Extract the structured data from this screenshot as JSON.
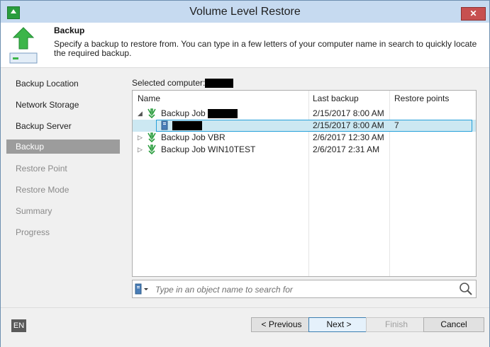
{
  "window": {
    "title": "Volume Level Restore",
    "close_label": "✕"
  },
  "header": {
    "title": "Backup",
    "description": "Specify a backup to restore from. You can type in a few letters of your computer name in search to quickly locate the required backup."
  },
  "nav": {
    "items": [
      {
        "label": "Backup Location",
        "state": "normal"
      },
      {
        "label": "Network Storage",
        "state": "normal"
      },
      {
        "label": "Backup Server",
        "state": "normal"
      },
      {
        "label": "Backup",
        "state": "active"
      },
      {
        "label": "Restore Point",
        "state": "disabled"
      },
      {
        "label": "Restore Mode",
        "state": "disabled"
      },
      {
        "label": "Summary",
        "state": "disabled"
      },
      {
        "label": "Progress",
        "state": "disabled"
      }
    ]
  },
  "main": {
    "selected_computer_label": "Selected computer:",
    "columns": [
      "Name",
      "Last backup",
      "Restore points"
    ],
    "rows": [
      {
        "name": "Backup Job",
        "last_backup": "2/15/2017 8:00 AM",
        "restore_points": "",
        "expanded": true,
        "level": 0
      },
      {
        "name": "",
        "last_backup": "2/15/2017 8:00 AM",
        "restore_points": "7",
        "level": 1,
        "selected": true
      },
      {
        "name": "Backup Job VBR",
        "last_backup": "2/6/2017 12:30 AM",
        "restore_points": "",
        "expanded": false,
        "level": 0
      },
      {
        "name": "Backup Job WIN10TEST",
        "last_backup": "2/6/2017 2:31 AM",
        "restore_points": "",
        "expanded": false,
        "level": 0
      }
    ],
    "search_placeholder": "Type in an object name to search for"
  },
  "footer": {
    "language": "EN",
    "previous_label": "< Previous",
    "next_label": "Next >",
    "finish_label": "Finish",
    "cancel_label": "Cancel"
  },
  "colors": {
    "accent": "#26a0da",
    "selection": "#cce8f2",
    "active_nav": "#9c9c9c",
    "job_icon": "#2a9d3e"
  }
}
